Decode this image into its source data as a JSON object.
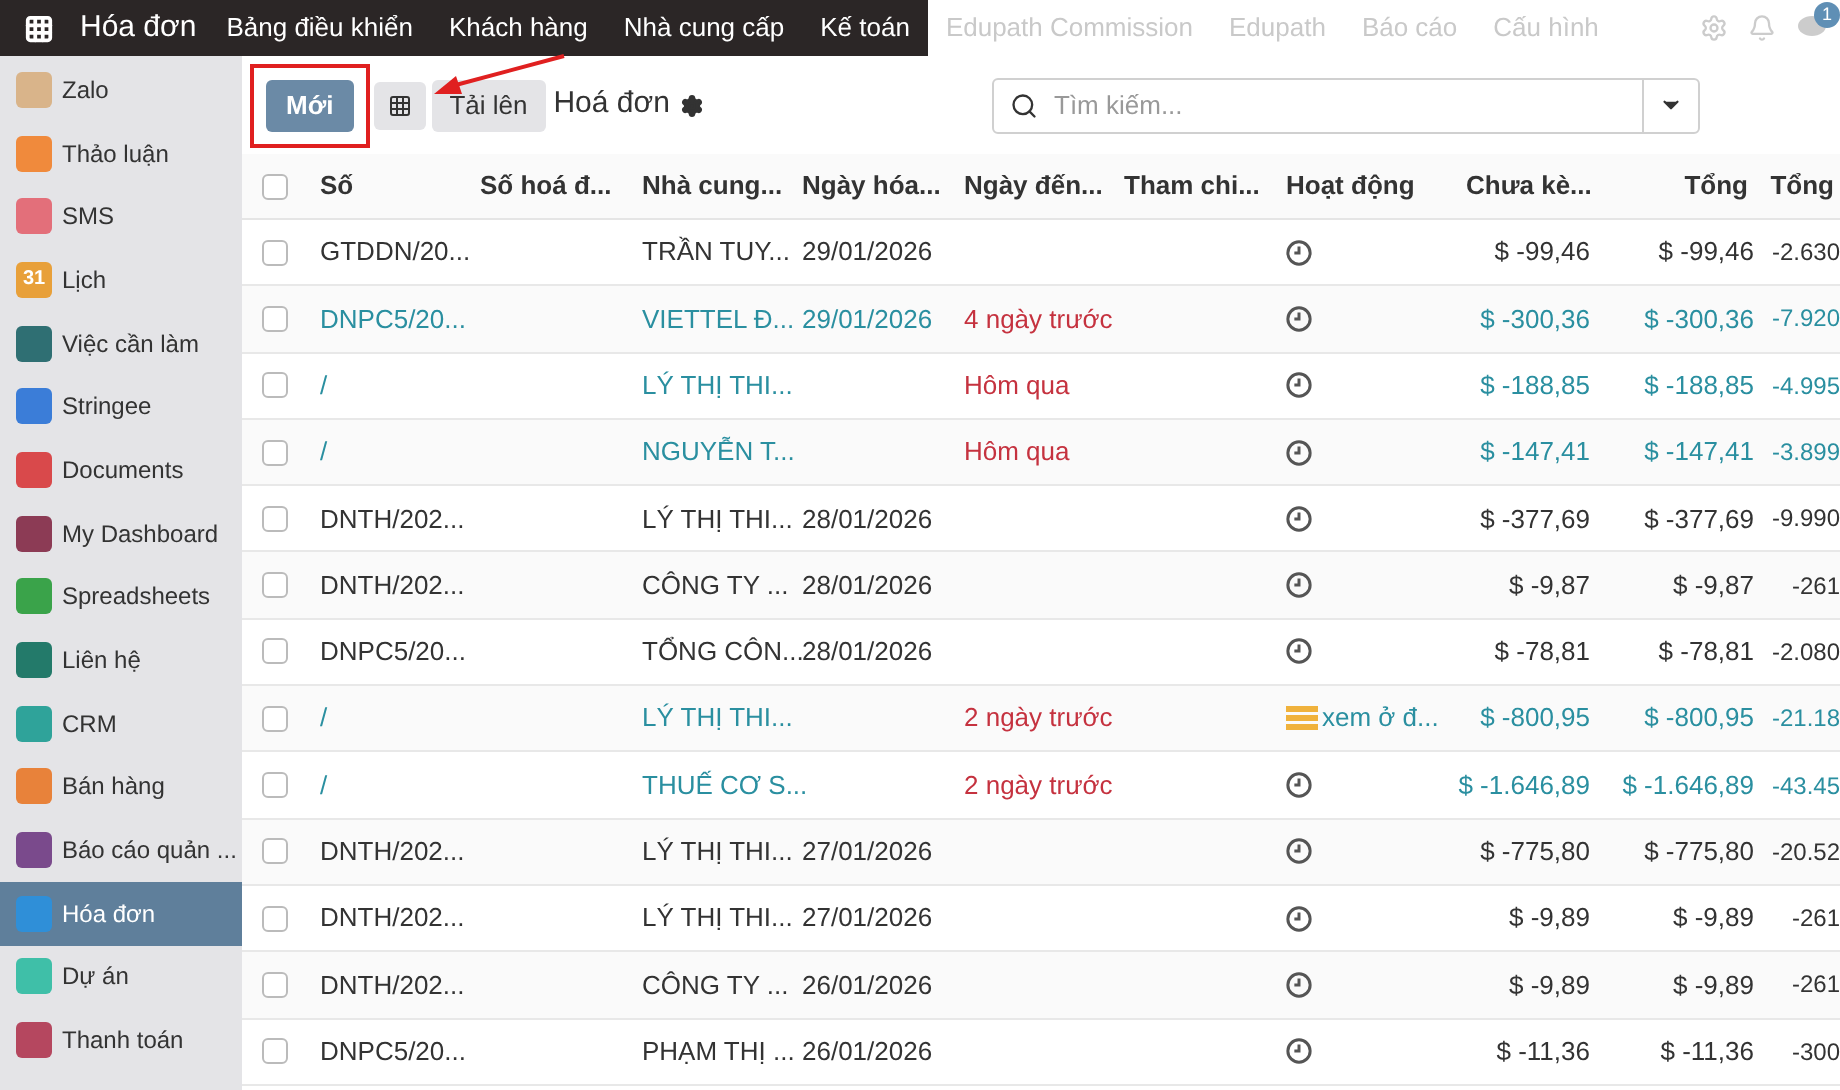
{
  "top_bar": {
    "app_title": "Hóa đơn",
    "menu": [
      {
        "label": "Bảng điều khiển",
        "faded": false
      },
      {
        "label": "Khách hàng",
        "faded": false
      },
      {
        "label": "Nhà cung cấp",
        "faded": false
      },
      {
        "label": "Kế toán",
        "faded": false
      },
      {
        "label": "Edupath Commission",
        "faded": true
      },
      {
        "label": "Edupath",
        "faded": true
      },
      {
        "label": "Báo cáo",
        "faded": true
      },
      {
        "label": "Cấu hình",
        "faded": true
      }
    ],
    "notification_count": "1"
  },
  "sidebar": {
    "items": [
      {
        "label": "Zalo",
        "color": "#d9b48a",
        "selected": false
      },
      {
        "label": "Thảo luận",
        "color": "#f08a3c",
        "selected": false
      },
      {
        "label": "SMS",
        "color": "#e36f7a",
        "selected": false
      },
      {
        "label": "Lịch",
        "color": "#e8a03a",
        "selected": false,
        "icon_text": "31"
      },
      {
        "label": "Việc cần làm",
        "color": "#2f6f73",
        "selected": false
      },
      {
        "label": "Stringee",
        "color": "#3b7dd8",
        "selected": false
      },
      {
        "label": "Documents",
        "color": "#d9494b",
        "selected": false
      },
      {
        "label": "My Dashboard",
        "color": "#8c3b55",
        "selected": false
      },
      {
        "label": "Spreadsheets",
        "color": "#3aa34a",
        "selected": false
      },
      {
        "label": "Liên hệ",
        "color": "#237a6a",
        "selected": false
      },
      {
        "label": "CRM",
        "color": "#2fa39a",
        "selected": false
      },
      {
        "label": "Bán hàng",
        "color": "#e8823a",
        "selected": false
      },
      {
        "label": "Báo cáo quản ...",
        "color": "#7a4a8c",
        "selected": false
      },
      {
        "label": "Hóa đơn",
        "color": "#2f8fd8",
        "selected": true
      },
      {
        "label": "Dự án",
        "color": "#3fbfa8",
        "selected": false
      },
      {
        "label": "Thanh toán",
        "color": "#b5475f",
        "selected": false
      }
    ]
  },
  "control_panel": {
    "new_button": "Mới",
    "upload_button": "Tải lên",
    "title": "Hoá đơn",
    "search": {
      "placeholder": "Tìm kiếm..."
    }
  },
  "table": {
    "all_checked": false,
    "columns": [
      "Số",
      "Số hoá đ...",
      "Nhà cung...",
      "Ngày hóa...",
      "Ngày đến...",
      "Tham chi...",
      "Hoạt động",
      "Chưa kè...",
      "Tổng",
      "Tổng"
    ],
    "rows": [
      {
        "number": "GTDDN/20...",
        "vendor": "TRẦN TUY...",
        "date": "29/01/2026",
        "due": "",
        "activity": {
          "kind": "clock"
        },
        "untaxed": "$ -99,46",
        "total": "$ -99,46",
        "total_2": "-2.630",
        "highlighted": false,
        "checked": false
      },
      {
        "number": "DNPC5/20...",
        "vendor": "VIETTEL Đ...",
        "date": "29/01/2026",
        "due": "4 ngày trước",
        "activity": {
          "kind": "clock"
        },
        "untaxed": "$ -300,36",
        "total": "$ -300,36",
        "total_2": "-7.920",
        "highlighted": true,
        "checked": false
      },
      {
        "number": "/",
        "vendor": "LÝ THỊ THI...",
        "date": "",
        "due": "Hôm qua",
        "activity": {
          "kind": "clock"
        },
        "untaxed": "$ -188,85",
        "total": "$ -188,85",
        "total_2": "-4.995",
        "highlighted": true,
        "checked": false
      },
      {
        "number": "/",
        "vendor": "NGUYỄN T...",
        "date": "",
        "due": "Hôm qua",
        "activity": {
          "kind": "clock"
        },
        "untaxed": "$ -147,41",
        "total": "$ -147,41",
        "total_2": "-3.899",
        "highlighted": true,
        "checked": false
      },
      {
        "number": "DNTH/202...",
        "vendor": "LÝ THỊ THI...",
        "date": "28/01/2026",
        "due": "",
        "activity": {
          "kind": "clock"
        },
        "untaxed": "$ -377,69",
        "total": "$ -377,69",
        "total_2": "-9.990",
        "highlighted": false,
        "checked": false
      },
      {
        "number": "DNTH/202...",
        "vendor": "CÔNG TY ...",
        "date": "28/01/2026",
        "due": "",
        "activity": {
          "kind": "clock"
        },
        "untaxed": "$ -9,87",
        "total": "$ -9,87",
        "total_2": "-261",
        "highlighted": false,
        "checked": false
      },
      {
        "number": "DNPC5/20...",
        "vendor": "TỔNG CÔN...",
        "date": "28/01/2026",
        "due": "",
        "activity": {
          "kind": "clock"
        },
        "untaxed": "$ -78,81",
        "total": "$ -78,81",
        "total_2": "-2.080",
        "highlighted": false,
        "checked": false
      },
      {
        "number": "/",
        "vendor": "LÝ THỊ THI...",
        "date": "",
        "due": "2 ngày trước",
        "activity": {
          "kind": "todo",
          "text": "xem ở đ..."
        },
        "untaxed": "$ -800,95",
        "total": "$ -800,95",
        "total_2": "-21.18",
        "highlighted": true,
        "checked": false
      },
      {
        "number": "/",
        "vendor": "THUẾ CƠ S...",
        "date": "",
        "due": "2 ngày trước",
        "activity": {
          "kind": "clock"
        },
        "untaxed": "$ -1.646,89",
        "total": "$ -1.646,89",
        "total_2": "-43.45",
        "highlighted": true,
        "checked": false
      },
      {
        "number": "DNTH/202...",
        "vendor": "LÝ THỊ THI...",
        "date": "27/01/2026",
        "due": "",
        "activity": {
          "kind": "clock"
        },
        "untaxed": "$ -775,80",
        "total": "$ -775,80",
        "total_2": "-20.52",
        "highlighted": false,
        "checked": false
      },
      {
        "number": "DNTH/202...",
        "vendor": "LÝ THỊ THI...",
        "date": "27/01/2026",
        "due": "",
        "activity": {
          "kind": "clock"
        },
        "untaxed": "$ -9,89",
        "total": "$ -9,89",
        "total_2": "-261",
        "highlighted": false,
        "checked": false
      },
      {
        "number": "DNTH/202...",
        "vendor": "CÔNG TY ...",
        "date": "26/01/2026",
        "due": "",
        "activity": {
          "kind": "clock"
        },
        "untaxed": "$ -9,89",
        "total": "$ -9,89",
        "total_2": "-261",
        "highlighted": false,
        "checked": false
      },
      {
        "number": "DNPC5/20...",
        "vendor": "PHẠM THỊ ...",
        "date": "26/01/2026",
        "due": "",
        "activity": {
          "kind": "clock"
        },
        "untaxed": "$ -11,36",
        "total": "$ -11,36",
        "total_2": "-300",
        "highlighted": false,
        "checked": false
      }
    ]
  }
}
